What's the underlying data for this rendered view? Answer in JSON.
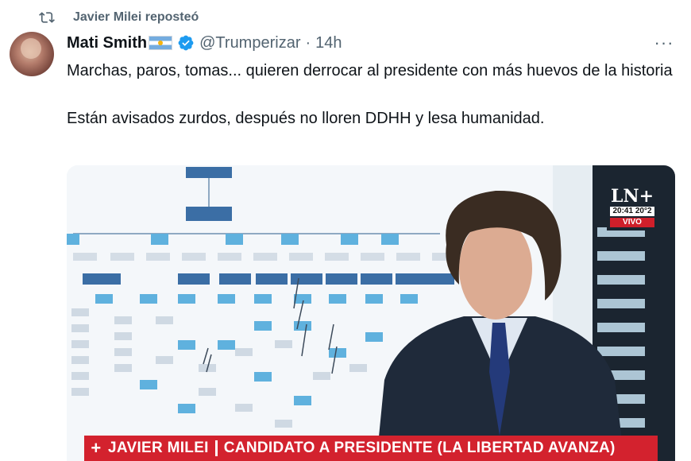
{
  "repost": {
    "label": "Javier Milei reposteó"
  },
  "post": {
    "author_name": "Mati Smith",
    "author_handle": "@Trumperizar",
    "separator": "·",
    "time": "14h",
    "more": "···",
    "paragraphs": [
      "Marchas, paros, tomas... quieren derrocar al presidente con más huevos de la historia",
      "Están avisados zurdos, después no lloren DDHH y lesa humanidad."
    ]
  },
  "video": {
    "channel_logo": "LN+",
    "clock": "20:41 20°2",
    "live": "VIVO",
    "lower_third": {
      "plus": "+",
      "name": "JAVIER MILEI",
      "caption": "CANDIDATO A PRESIDENTE (LA LIBERTAD AVANZA)"
    }
  },
  "icons": {
    "repost": "repost-icon",
    "verified": "verified-badge-icon",
    "flag": "argentina-flag-icon",
    "more": "more-options-icon"
  },
  "colors": {
    "secondary_text": "#536471",
    "verified": "#1d9bf0",
    "lower_third": "#d3222e"
  }
}
